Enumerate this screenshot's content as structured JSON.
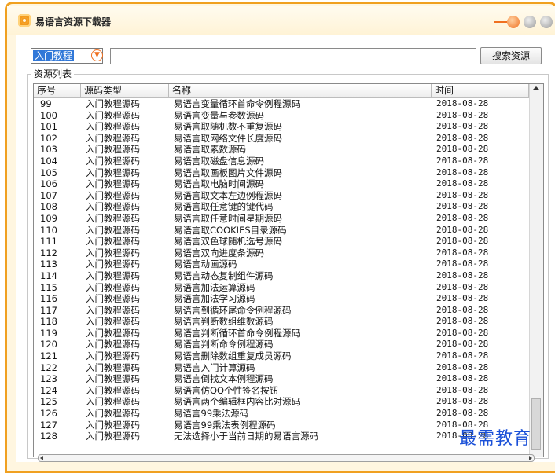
{
  "window": {
    "title": "易语言资源下载器"
  },
  "search": {
    "category_value": "入门教程",
    "query": "",
    "button_label": "搜索资源"
  },
  "group": {
    "title": "资源列表"
  },
  "columns": [
    "序号",
    "源码类型",
    "名称",
    "时间"
  ],
  "rows": [
    {
      "num": "99",
      "type": "入门教程源码",
      "name": "易语言变量循环首命令例程源码",
      "time": "2018-08-28"
    },
    {
      "num": "100",
      "type": "入门教程源码",
      "name": "易语言变量与参数源码",
      "time": "2018-08-28"
    },
    {
      "num": "101",
      "type": "入门教程源码",
      "name": "易语言取随机数不重复源码",
      "time": "2018-08-28"
    },
    {
      "num": "102",
      "type": "入门教程源码",
      "name": "易语言取网络文件长度源码",
      "time": "2018-08-28"
    },
    {
      "num": "103",
      "type": "入门教程源码",
      "name": "易语言取素数源码",
      "time": "2018-08-28"
    },
    {
      "num": "104",
      "type": "入门教程源码",
      "name": "易语言取磁盘信息源码",
      "time": "2018-08-28"
    },
    {
      "num": "105",
      "type": "入门教程源码",
      "name": "易语言取画板图片文件源码",
      "time": "2018-08-28"
    },
    {
      "num": "106",
      "type": "入门教程源码",
      "name": "易语言取电脑时间源码",
      "time": "2018-08-28"
    },
    {
      "num": "107",
      "type": "入门教程源码",
      "name": "易语言取文本左边例程源码",
      "time": "2018-08-28"
    },
    {
      "num": "108",
      "type": "入门教程源码",
      "name": "易语言取任意键的键代码",
      "time": "2018-08-28"
    },
    {
      "num": "109",
      "type": "入门教程源码",
      "name": "易语言取任意时间星期源码",
      "time": "2018-08-28"
    },
    {
      "num": "110",
      "type": "入门教程源码",
      "name": "易语言取COOKIES目录源码",
      "time": "2018-08-28"
    },
    {
      "num": "111",
      "type": "入门教程源码",
      "name": "易语言双色球随机选号源码",
      "time": "2018-08-28"
    },
    {
      "num": "112",
      "type": "入门教程源码",
      "name": "易语言双向进度条源码",
      "time": "2018-08-28"
    },
    {
      "num": "113",
      "type": "入门教程源码",
      "name": "易语言动画源码",
      "time": "2018-08-28"
    },
    {
      "num": "114",
      "type": "入门教程源码",
      "name": "易语言动态复制组件源码",
      "time": "2018-08-28"
    },
    {
      "num": "115",
      "type": "入门教程源码",
      "name": "易语言加法运算源码",
      "time": "2018-08-28"
    },
    {
      "num": "116",
      "type": "入门教程源码",
      "name": "易语言加法学习源码",
      "time": "2018-08-28"
    },
    {
      "num": "117",
      "type": "入门教程源码",
      "name": "易语言到循环尾命令例程源码",
      "time": "2018-08-28"
    },
    {
      "num": "118",
      "type": "入门教程源码",
      "name": "易语言判断数组维数源码",
      "time": "2018-08-28"
    },
    {
      "num": "119",
      "type": "入门教程源码",
      "name": "易语言判断循环首命令例程源码",
      "time": "2018-08-28"
    },
    {
      "num": "120",
      "type": "入门教程源码",
      "name": "易语言判断命令例程源码",
      "time": "2018-08-28"
    },
    {
      "num": "121",
      "type": "入门教程源码",
      "name": "易语言删除数组重复成员源码",
      "time": "2018-08-28"
    },
    {
      "num": "122",
      "type": "入门教程源码",
      "name": "易语言入门计算源码",
      "time": "2018-08-28"
    },
    {
      "num": "123",
      "type": "入门教程源码",
      "name": "易语言倒找文本例程源码",
      "time": "2018-08-28"
    },
    {
      "num": "124",
      "type": "入门教程源码",
      "name": "易语言仿QQ个性签名按钮",
      "time": "2018-08-28"
    },
    {
      "num": "125",
      "type": "入门教程源码",
      "name": "易语言两个编辑框内容比对源码",
      "time": "2018-08-28"
    },
    {
      "num": "126",
      "type": "入门教程源码",
      "name": "易语言99乘法源码",
      "time": "2018-08-28"
    },
    {
      "num": "127",
      "type": "入门教程源码",
      "name": "易语言99乘法表例程源码",
      "time": "2018-08-28"
    },
    {
      "num": "128",
      "type": "入门教程源码",
      "name": "无法选择小于当前日期的易语言源码",
      "time": "2018-08-28"
    }
  ],
  "watermark": "最需教育",
  "colors": {
    "frame_orange": "#f0a020",
    "selection_blue": "#3178d8",
    "watermark_blue": "#1a50d8"
  }
}
